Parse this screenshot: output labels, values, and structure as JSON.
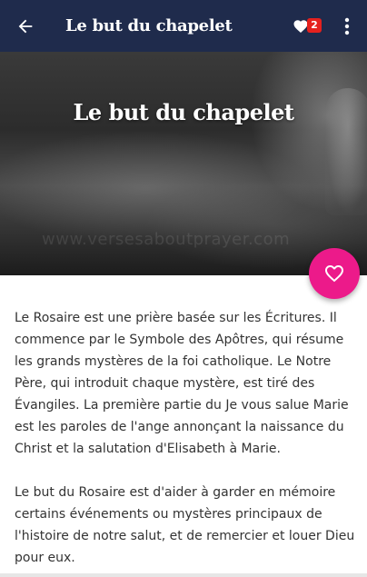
{
  "app_bar": {
    "title": "Le but du chapelet",
    "favorites_count": "2"
  },
  "hero": {
    "title": "Le but du chapelet",
    "watermark": "www.versesaboutprayer.com"
  },
  "article": {
    "paragraphs": [
      "Le Rosaire est une prière basée sur les Écritures. Il commence par le Symbole des Apôtres, qui résume les grands mystères de la foi catholique. Le Notre Père, qui introduit chaque mystère, est tiré des Évangiles. La première partie du Je vous salue Marie est les paroles de l'ange annonçant la naissance du Christ et la salutation d'Elisabeth à Marie.",
      "Le but du Rosaire est d'aider à garder en mémoire certains événements ou mystères principaux de l'histoire de notre salut, et de remercier et louer Dieu pour eux."
    ]
  },
  "colors": {
    "app_bar": "#1f2b4c",
    "fab": "#ec1a8a",
    "badge": "#e5211e",
    "text": "#333333"
  },
  "icons": {
    "back": "arrow-left-icon",
    "favorites": "heart-icon",
    "menu": "more-vertical-icon",
    "fab": "heart-outline-icon"
  }
}
